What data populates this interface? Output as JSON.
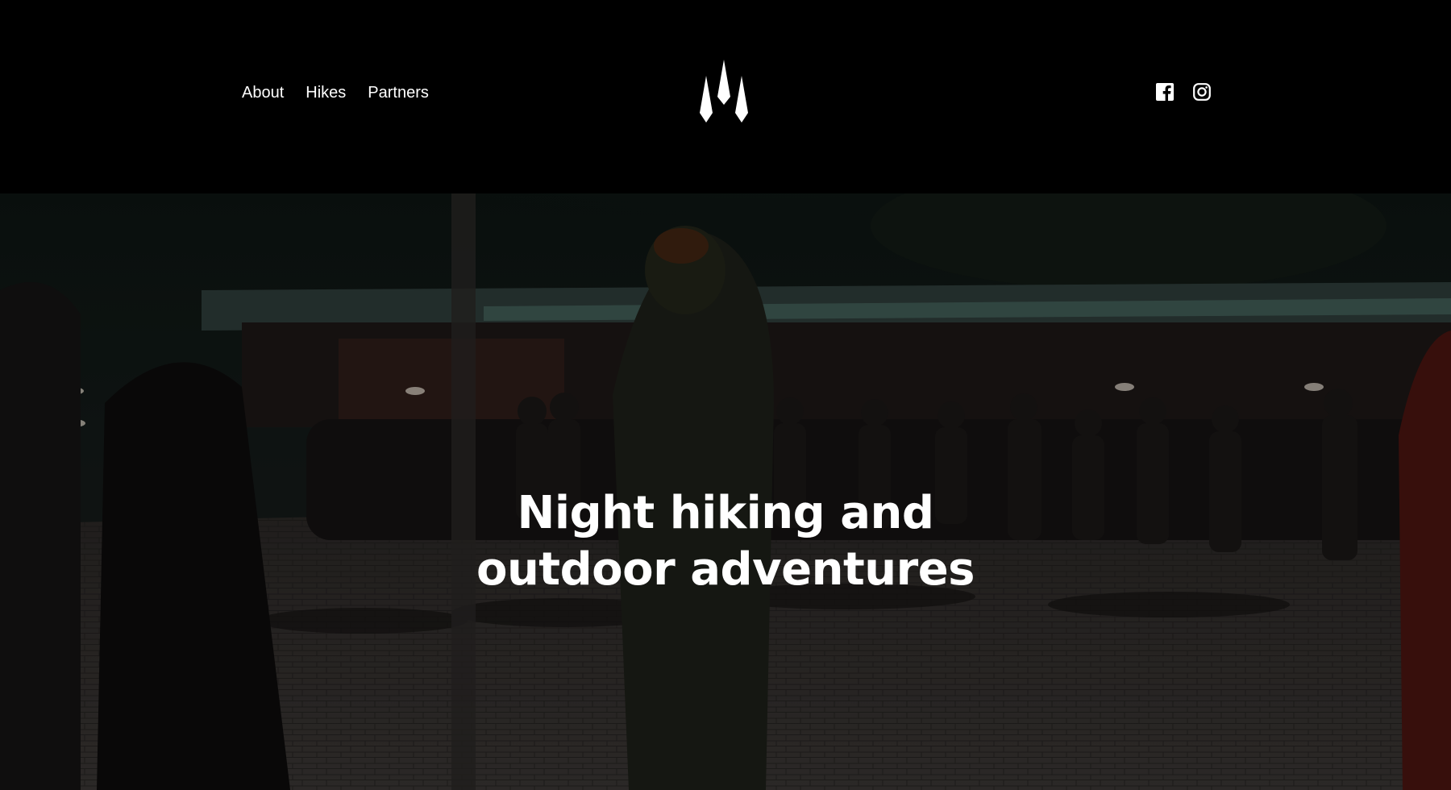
{
  "nav": {
    "items": [
      {
        "label": "About"
      },
      {
        "label": "Hikes"
      },
      {
        "label": "Partners"
      }
    ]
  },
  "logo": {
    "icon": "three-peaks-logo-icon"
  },
  "social": {
    "items": [
      {
        "icon": "facebook-icon"
      },
      {
        "icon": "instagram-icon"
      }
    ]
  },
  "hero": {
    "title_line1": "Night hiking and",
    "title_line2": "outdoor adventures",
    "background": "night-group-hike-photo"
  },
  "colors": {
    "background": "#000000",
    "text": "#ffffff"
  }
}
